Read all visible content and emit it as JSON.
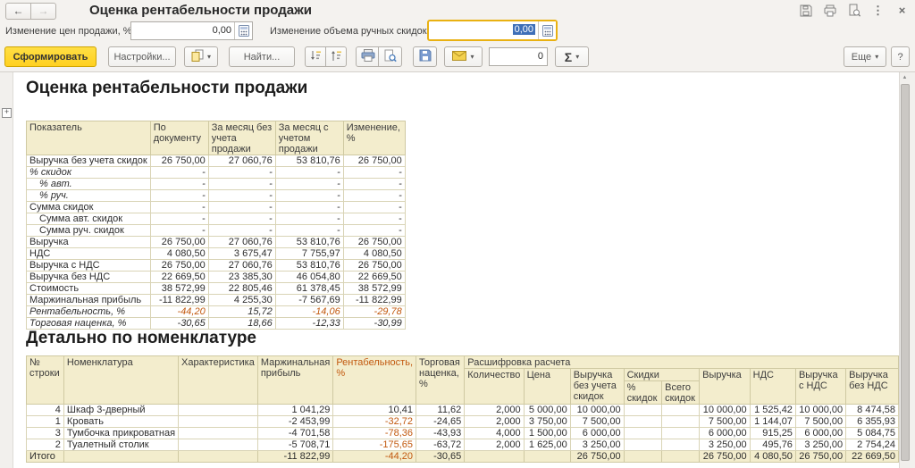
{
  "titlebar": {
    "title": "Оценка рентабельности продажи"
  },
  "params": {
    "price_label": "Изменение цен продажи, %:",
    "price_value": "0,00",
    "discount_label": "Изменение объема ручных скидок, %:",
    "discount_value": "0,00"
  },
  "toolbar": {
    "generate": "Сформировать",
    "settings": "Настройки...",
    "find": "Найти...",
    "counter": "0",
    "more": "Еще",
    "help": "?"
  },
  "icons": {
    "back": "←",
    "forward": "→",
    "dropdown": "▾",
    "more_vertical": "⋮",
    "close": "×",
    "expander": "+",
    "scroll_up": "▲",
    "sigma": "Σ"
  },
  "report": {
    "title": "Оценка рентабельности продажи",
    "detail_title": "Детально по номенклатуре",
    "summary": {
      "headers": [
        "Показатель",
        "По документу",
        "За месяц без учета продажи",
        "За месяц с учетом продажи",
        "Изменение, %"
      ],
      "rows": [
        {
          "label": "Выручка без учета скидок",
          "values": [
            "26 750,00",
            "27 060,76",
            "53 810,76",
            "26 750,00"
          ]
        },
        {
          "label": "% скидок",
          "italic": true,
          "values": [
            "-",
            "-",
            "-",
            "-"
          ]
        },
        {
          "label": "% авт.",
          "italic": true,
          "indent": 1,
          "values": [
            "-",
            "-",
            "-",
            "-"
          ]
        },
        {
          "label": "% руч.",
          "italic": true,
          "indent": 1,
          "values": [
            "-",
            "-",
            "-",
            "-"
          ]
        },
        {
          "label": "Сумма скидок",
          "values": [
            "-",
            "-",
            "-",
            "-"
          ]
        },
        {
          "label": "Сумма авт. скидок",
          "indent": 1,
          "values": [
            "-",
            "-",
            "-",
            "-"
          ]
        },
        {
          "label": "Сумма руч. скидок",
          "indent": 1,
          "values": [
            "-",
            "-",
            "-",
            "-"
          ]
        },
        {
          "label": "Выручка",
          "values": [
            "26 750,00",
            "27 060,76",
            "53 810,76",
            "26 750,00"
          ]
        },
        {
          "label": "НДС",
          "values": [
            "4 080,50",
            "3 675,47",
            "7 755,97",
            "4 080,50"
          ]
        },
        {
          "label": "Выручка с НДС",
          "values": [
            "26 750,00",
            "27 060,76",
            "53 810,76",
            "26 750,00"
          ]
        },
        {
          "label": "Выручка без НДС",
          "values": [
            "22 669,50",
            "23 385,30",
            "46 054,80",
            "22 669,50"
          ]
        },
        {
          "label": "Стоимость",
          "values": [
            "38 572,99",
            "22 805,46",
            "61 378,45",
            "38 572,99"
          ]
        },
        {
          "label": "Маржинальная прибыль",
          "values": [
            "-11 822,99",
            "4 255,30",
            "-7 567,69",
            "-11 822,99"
          ]
        },
        {
          "label": "Рентабельность, %",
          "italic": true,
          "red_negatives": true,
          "values": [
            "-44,20",
            "15,72",
            "-14,06",
            "-29,78"
          ]
        },
        {
          "label": "Торговая наценка, %",
          "italic": true,
          "values": [
            "-30,65",
            "18,66",
            "-12,33",
            "-30,99"
          ]
        }
      ]
    },
    "detail": {
      "headers": {
        "row_number": "№ строки",
        "nomenclature": "Номенклатура",
        "characteristic": "Характеристика",
        "margin": "Маржинальная прибыль",
        "profitability": "Рентабельность, %",
        "markup": "Торговая наценка, %",
        "calc_group": "Расшифровка расчета",
        "quantity": "Количество",
        "price": "Цена",
        "revenue_no_disc": "Выручка без учета скидок",
        "discounts_group": "Скидки",
        "disc_pct": "% скидок",
        "disc_total": "Всего скидок",
        "revenue": "Выручка",
        "vat": "НДС",
        "revenue_with_vat": "Выручка с НДС",
        "revenue_no_vat": "Выручка без НДС"
      },
      "rows": [
        [
          "4",
          "Шкаф 3-дверный",
          "",
          "1 041,29",
          "10,41",
          "11,62",
          "2,000",
          "5 000,00",
          "10 000,00",
          "",
          "",
          "10 000,00",
          "1 525,42",
          "10 000,00",
          "8 474,58"
        ],
        [
          "1",
          "Кровать",
          "",
          "-2 453,99",
          "-32,72",
          "-24,65",
          "2,000",
          "3 750,00",
          "7 500,00",
          "",
          "",
          "7 500,00",
          "1 144,07",
          "7 500,00",
          "6 355,93"
        ],
        [
          "3",
          "Тумбочка прикроватная",
          "",
          "-4 701,58",
          "-78,36",
          "-43,93",
          "4,000",
          "1 500,00",
          "6 000,00",
          "",
          "",
          "6 000,00",
          "915,25",
          "6 000,00",
          "5 084,75"
        ],
        [
          "2",
          "Туалетный столик",
          "",
          "-5 708,71",
          "-175,65",
          "-63,72",
          "2,000",
          "1 625,00",
          "3 250,00",
          "",
          "",
          "3 250,00",
          "495,76",
          "3 250,00",
          "2 754,24"
        ]
      ],
      "total": [
        "Итого",
        "",
        "",
        "-11 822,99",
        "-44,20",
        "-30,65",
        "",
        "",
        "26 750,00",
        "",
        "",
        "26 750,00",
        "4 080,50",
        "26 750,00",
        "22 669,50"
      ]
    }
  },
  "colors": {
    "accent_yellow": "#FFD632",
    "focus_border": "#E9B112",
    "negative_red": "#C2590F",
    "table_header_bg": "#F3EDCD",
    "selection_blue": "#3E6FB8"
  }
}
